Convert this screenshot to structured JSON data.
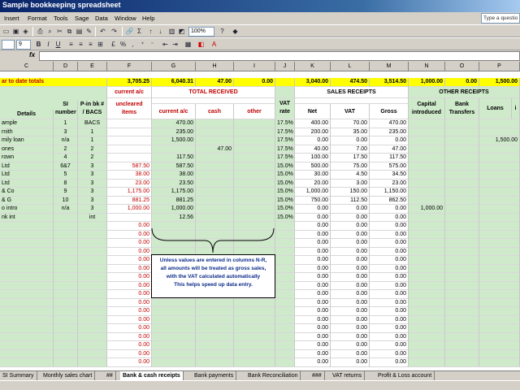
{
  "window": {
    "title": "Sample bookkeeping spreadsheet"
  },
  "menu": [
    "Insert",
    "Format",
    "Tools",
    "Sage",
    "Data",
    "Window",
    "Help"
  ],
  "help_box": {
    "placeholder": "Type a questio"
  },
  "toolbar": {
    "zoom": "100%",
    "font_size": "9"
  },
  "columns": [
    "C",
    "D",
    "E",
    "F",
    "G",
    "H",
    "I",
    "J",
    "K",
    "L",
    "M",
    "N",
    "O",
    "P"
  ],
  "totals_row": {
    "label": "ar to date totals",
    "F": "3,705.25",
    "G": "6,040.31",
    "H": "47.00",
    "I": "0.00",
    "K": "3,040.00",
    "L": "474.50",
    "M": "3,514.50",
    "N": "1,000.00",
    "O": "0.00",
    "P": "1,500.00"
  },
  "headers": {
    "details": "Details",
    "sl_number": "SI number",
    "pin_bk": "P-in bk # / BACS",
    "current_ac_top": "current a/c",
    "uncleared": "uncleared items",
    "total_received": "TOTAL RECEIVED",
    "current_ac": "current a/c",
    "cash": "cash",
    "other": "other",
    "vat_rate": "VAT rate",
    "sales_receipts": "SALES RECEIPTS",
    "net": "Net",
    "vat": "VAT",
    "gross": "Gross",
    "other_receipts": "OTHER RECEIPTS",
    "capital": "Capital introduced",
    "bank_transfers": "Bank Transfers",
    "loans": "Loans",
    "i_col": "i"
  },
  "rows": [
    {
      "c": "ample",
      "d": "1",
      "e": "BACS",
      "f": "",
      "g": "470.00",
      "h": "",
      "i": "",
      "j": "17.5%",
      "k": "400.00",
      "l": "70.00",
      "m": "470.00",
      "n": "",
      "o": "",
      "p": ""
    },
    {
      "c": "rnith",
      "d": "3",
      "e": "1",
      "f": "",
      "g": "235.00",
      "h": "",
      "i": "",
      "j": "17.5%",
      "k": "200.00",
      "l": "35.00",
      "m": "235.00",
      "n": "",
      "o": "",
      "p": ""
    },
    {
      "c": "mily loan",
      "d": "n/a",
      "e": "1",
      "f": "",
      "g": "1,500.00",
      "h": "",
      "i": "",
      "j": "17.5%",
      "k": "0.00",
      "l": "0.00",
      "m": "0.00",
      "n": "",
      "o": "",
      "p": "1,500.00"
    },
    {
      "c": "ones",
      "d": "2",
      "e": "2",
      "f": "",
      "g": "",
      "h": "47.00",
      "i": "",
      "j": "17.5%",
      "k": "40.00",
      "l": "7.00",
      "m": "47.00",
      "n": "",
      "o": "",
      "p": ""
    },
    {
      "c": "rown",
      "d": "4",
      "e": "2",
      "f": "",
      "g": "117.50",
      "h": "",
      "i": "",
      "j": "17.5%",
      "k": "100.00",
      "l": "17.50",
      "m": "117.50",
      "n": "",
      "o": "",
      "p": ""
    },
    {
      "c": "Ltd",
      "d": "6&7",
      "e": "3",
      "f": "587.50",
      "g": "587.50",
      "h": "",
      "i": "",
      "j": "15.0%",
      "k": "500.00",
      "l": "75.00",
      "m": "575.00",
      "n": "",
      "o": "",
      "p": ""
    },
    {
      "c": "Ltd",
      "d": "5",
      "e": "3",
      "f": "38.00",
      "g": "38.00",
      "h": "",
      "i": "",
      "j": "15.0%",
      "k": "30.00",
      "l": "4.50",
      "m": "34.50",
      "n": "",
      "o": "",
      "p": ""
    },
    {
      "c": "Ltd",
      "d": "8",
      "e": "3",
      "f": "23.00",
      "g": "23.50",
      "h": "",
      "i": "",
      "j": "15.0%",
      "k": "20.00",
      "l": "3.00",
      "m": "23.00",
      "n": "",
      "o": "",
      "p": ""
    },
    {
      "c": "& Co",
      "d": "9",
      "e": "3",
      "f": "1,175.00",
      "g": "1,175.00",
      "h": "",
      "i": "",
      "j": "15.0%",
      "k": "1,000.00",
      "l": "150.00",
      "m": "1,150.00",
      "n": "",
      "o": "",
      "p": ""
    },
    {
      "c": "& G",
      "d": "10",
      "e": "3",
      "f": "881.25",
      "g": "881.25",
      "h": "",
      "i": "",
      "j": "15.0%",
      "k": "750.00",
      "l": "112.50",
      "m": "862.50",
      "n": "",
      "o": "",
      "p": ""
    },
    {
      "c": "o intro",
      "d": "n/a",
      "e": "3",
      "f": "1,000.00",
      "g": "1,000.00",
      "h": "",
      "i": "",
      "j": "15.0%",
      "k": "0.00",
      "l": "0.00",
      "m": "0.00",
      "n": "1,000.00",
      "o": "",
      "p": ""
    },
    {
      "c": "nk int",
      "d": "",
      "e": "int",
      "f": "",
      "g": "12.56",
      "h": "",
      "i": "",
      "j": "15.0%",
      "k": "0.00",
      "l": "0.00",
      "m": "0.00",
      "n": "",
      "o": "",
      "p": ""
    }
  ],
  "empty_row_values": {
    "f": "0.00",
    "k": "0.00",
    "l": "0.00",
    "m": "0.00"
  },
  "callout": {
    "line1": "Unless values are entered in columns N-R,",
    "line2": "all amounts will be treated as gross sales,",
    "line3": "with the VAT calculated automatically",
    "line4": "This helps speed up data entry."
  },
  "sheet_tabs": [
    {
      "label": "SI Summary",
      "active": false
    },
    {
      "label": "Monthly sales chart",
      "active": false
    },
    {
      "label": "##",
      "active": false
    },
    {
      "label": "Bank & cash receipts",
      "active": true
    },
    {
      "label": "Bank payments",
      "active": false
    },
    {
      "label": "Bank Reconciliation",
      "active": false
    },
    {
      "label": "###",
      "active": false
    },
    {
      "label": "VAT returns",
      "active": false
    },
    {
      "label": "Profit & Loss account",
      "active": false
    }
  ],
  "colors": {
    "green": "#cfeacb",
    "yellow": "#ffff00",
    "red_text": "#c00000",
    "title_blue": "#0a246a"
  }
}
